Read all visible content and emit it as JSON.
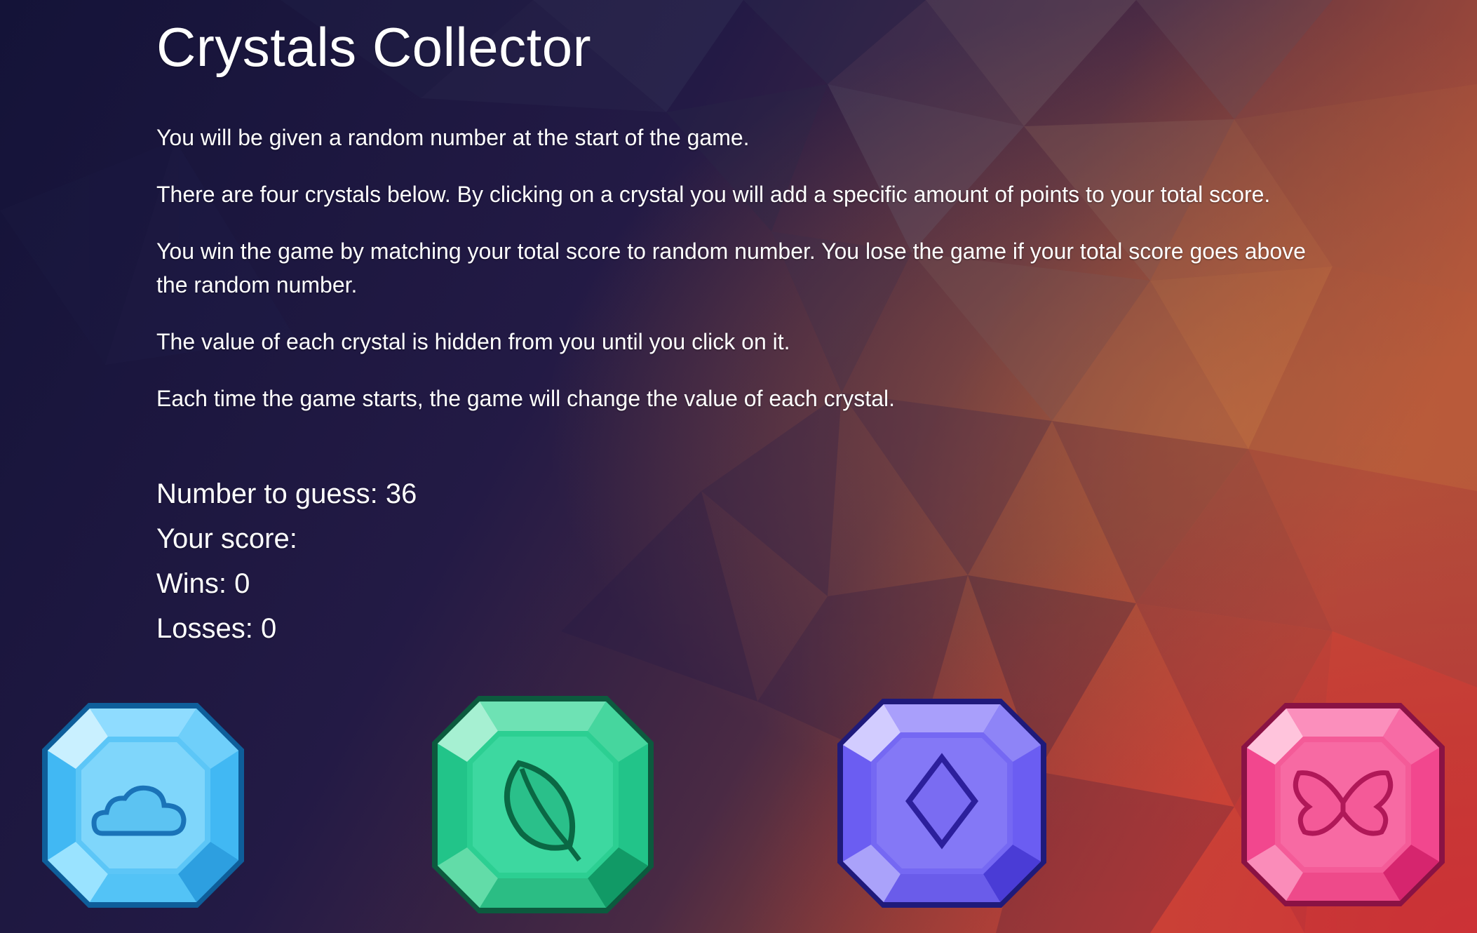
{
  "title": "Crystals Collector",
  "rules": [
    "You will be given a random number at the start of the game.",
    "There are four crystals below. By clicking on a crystal you will add a specific amount of points to your total score.",
    "You win the game by matching your total score to random number. You lose the game if your total score goes above the random number.",
    "The value of each crystal is hidden from you until you click on it.",
    "Each time the game starts, the game will change the value of each crystal."
  ],
  "stats": {
    "number_to_guess": "Number to guess: 36",
    "your_score": "Your score:",
    "wins": "Wins: 0",
    "losses": "Losses: 0"
  },
  "crystals": [
    {
      "color": "#3fb6f2",
      "icon": "cloud-icon"
    },
    {
      "color": "#21c48a",
      "icon": "leaf-icon"
    },
    {
      "color": "#6a5cf0",
      "icon": "diamond-icon"
    },
    {
      "color": "#f2478e",
      "icon": "butterfly-icon"
    }
  ],
  "colors": {
    "background_dark": "#161437",
    "background_warm": "#b8452f"
  }
}
